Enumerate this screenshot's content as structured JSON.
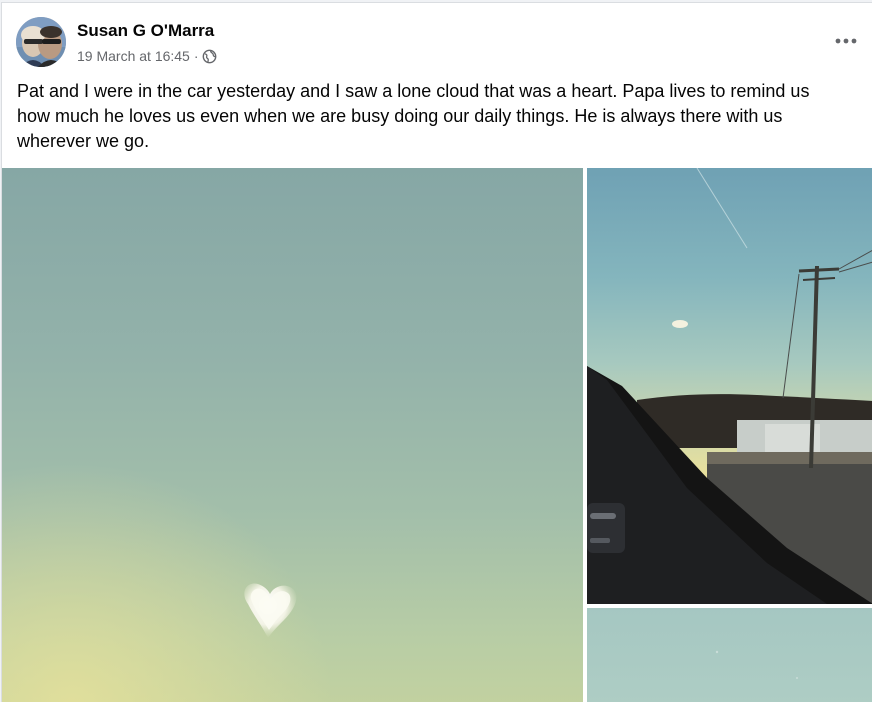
{
  "post": {
    "author": "Susan G O'Marra",
    "timestamp": "19 March at 16:45",
    "separator": "·",
    "audience_icon": "globe-icon",
    "more_icon": "more-horizontal-icon",
    "caption": "Pat and I were in the car yesterday and I saw a lone cloud that was a heart. Papa lives to remind us how much he loves us even when we are busy doing our daily things. He is always there with us wherever we go."
  },
  "colors": {
    "author_text": "#050505",
    "meta_text": "#65676b",
    "card_background": "#ffffff",
    "page_background": "#f0f2f5"
  },
  "photos": [
    {
      "name": "heart-cloud-close-up"
    },
    {
      "name": "sky-through-car-window"
    },
    {
      "name": "sky-partial"
    }
  ]
}
